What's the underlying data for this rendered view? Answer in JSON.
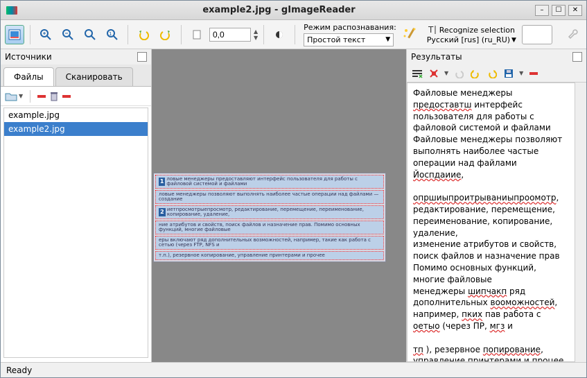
{
  "window": {
    "title": "example2.jpg - gImageReader"
  },
  "toolbar": {
    "zoom_value": "0,0",
    "recog_label": "Режим распознавания:",
    "recog_mode": "Простой текст",
    "recognize_selection": "Recognize selection",
    "recognize_lang": "Русский [rus] (ru_RU)"
  },
  "sources": {
    "title": "Источники",
    "tabs": {
      "files": "Файлы",
      "scan": "Сканировать"
    },
    "files": [
      "example.jpg",
      "example2.jpg"
    ],
    "selected_index": 1
  },
  "results": {
    "title": "Результаты",
    "text_parts": [
      {
        "t": "Файловые менеджеры "
      },
      {
        "t": "предоставтш",
        "sq": true
      },
      {
        "t": " интерфейс пользователя для работы с файловой системой и файлами"
      },
      {
        "br": true
      },
      {
        "t": "Файловые менеджеры позволяют выполнять наиболее частые операции над файлами "
      },
      {
        "t": "Йоспдаиие",
        "sq": true
      },
      {
        "t": ","
      },
      {
        "br": true
      },
      {
        "br": true
      },
      {
        "t": "опршиыпроитрываниыпроомотр",
        "sq": true
      },
      {
        "t": ", редактирование, перемещение, переименование, копирование, удаление,"
      },
      {
        "br": true
      },
      {
        "t": "изменение атрибутов и свойств, поиск файлов и назначение прав"
      },
      {
        "br": true
      },
      {
        "t": "Помимо основных функций, многие файловые"
      },
      {
        "br": true
      },
      {
        "t": "менеджеры "
      },
      {
        "t": "шипчакп",
        "sq": true
      },
      {
        "t": " ряд дополнительных "
      },
      {
        "t": "вооможностей",
        "sq": true
      },
      {
        "t": ", например, "
      },
      {
        "t": "пких",
        "sq": true
      },
      {
        "t": " пав работа с "
      },
      {
        "t": "оетыо",
        "sq": true
      },
      {
        "t": " (через ПР, "
      },
      {
        "t": "мгз",
        "sq": true
      },
      {
        "t": " и"
      },
      {
        "br": true
      },
      {
        "br": true
      },
      {
        "t": "тп",
        "sq": true
      },
      {
        "t": " ), резервное "
      },
      {
        "t": "попирование",
        "sq": true
      },
      {
        "t": ", управление принтерами и "
      },
      {
        "t": "процее",
        "sq": true
      }
    ]
  },
  "doc_preview": {
    "lines": [
      {
        "n": "1",
        "t": "ловые менеджеры предоставляют интерфейс пользователя для работы с файловой системой и файлами"
      },
      {
        "n": "",
        "t": "ловые менеджеры позволяют выполнять наиболее частые операции над файлами — создание"
      },
      {
        "n": "2",
        "t": "иетпросмотрыепросмотр, редактирование, перемещение, переименование, копирование, удаление,"
      },
      {
        "n": "",
        "t": "ние атрибутов и свойств, поиск файлов и назначение прав. Помимо основных функций, многие файловые"
      },
      {
        "n": "",
        "t": "еры включают ряд дополнительных возможностей, например, такие как работа с сетью (через FTP, NFS и"
      },
      {
        "n": "",
        "t": "т.п.), резервное копирование, управление принтерами и прочее"
      }
    ]
  },
  "status": {
    "text": "Ready"
  }
}
